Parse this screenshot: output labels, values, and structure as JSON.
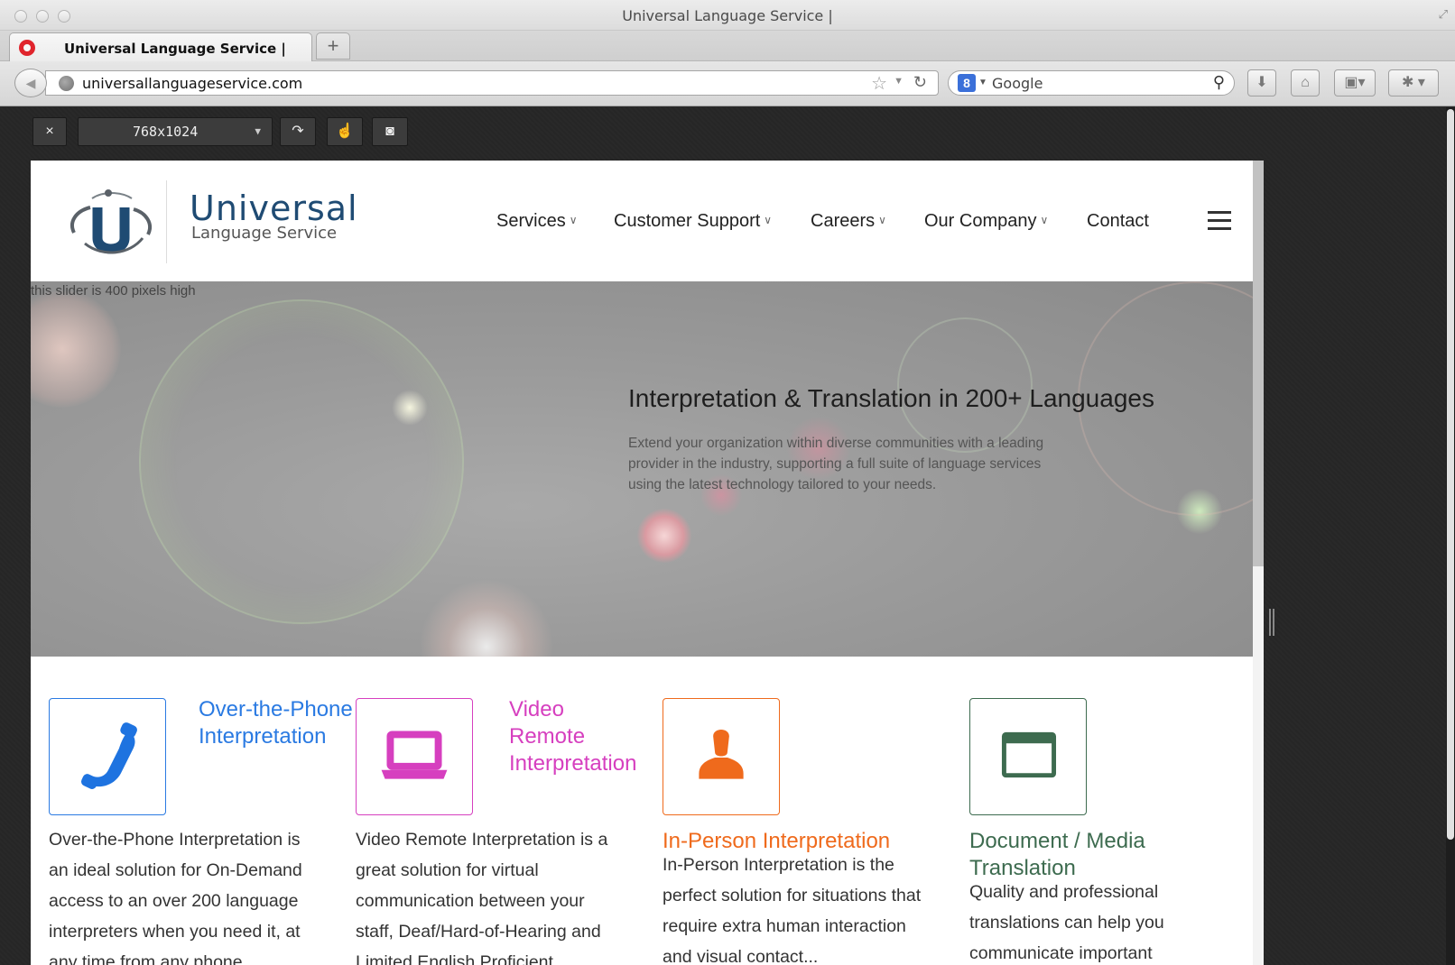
{
  "window": {
    "title": "Universal Language Service |"
  },
  "tabs": [
    {
      "label": "Universal Language Service |"
    }
  ],
  "new_tab_label": "+",
  "address_bar": {
    "url": "universallanguageservice.com"
  },
  "search_bar": {
    "engine_badge": "8",
    "placeholder": "Google"
  },
  "responsive_tool": {
    "close_label": "×",
    "size_value": "768x1024"
  },
  "site": {
    "logo": {
      "word": "Universal",
      "subtitle": "Language Service"
    },
    "nav": [
      {
        "label": "Services",
        "has_dropdown": true
      },
      {
        "label": "Customer Support",
        "has_dropdown": true
      },
      {
        "label": "Careers",
        "has_dropdown": true
      },
      {
        "label": "Our Company",
        "has_dropdown": true
      },
      {
        "label": "Contact",
        "has_dropdown": false
      }
    ],
    "hero": {
      "note": "this slider is 400 pixels high",
      "title": "Interpretation & Translation in 200+ Languages",
      "text": "Extend your organization within diverse communities with a leading provider in the industry, supporting a full suite of language services using the latest technology tailored to your needs."
    },
    "features": [
      {
        "title_lines": [
          "Over-the-Phone",
          "Interpretation"
        ],
        "desc_lines": [
          "Over-the-Phone Interpretation is",
          "an ideal solution for On-Demand",
          "access to an over 200 language",
          "interpreters when you need it, at",
          "any time from any phone..."
        ],
        "icon": "phone-icon",
        "color": "#2a7ae2"
      },
      {
        "title_lines": [
          "Video",
          "Remote",
          "Interpretation"
        ],
        "desc_lines": [
          "Video Remote Interpretation is a",
          "great solution for virtual",
          "communication between your",
          "staff, Deaf/Hard-of-Hearing and",
          "Limited English Proficient..."
        ],
        "icon": "laptop-icon",
        "color": "#d63fbf"
      },
      {
        "title_lines": [
          "In-Person Interpretation"
        ],
        "desc_lines": [
          "In-Person Interpretation is the",
          "perfect solution for situations that",
          "require extra human interaction",
          "and visual contact..."
        ],
        "icon": "person-icon",
        "color": "#ef6a1c"
      },
      {
        "title_lines": [
          "Document / Media",
          "Translation"
        ],
        "desc_lines": [
          "Quality and professional",
          "translations can help you",
          "communicate important"
        ],
        "icon": "folder-icon",
        "color": "#3d6b4f"
      }
    ]
  }
}
